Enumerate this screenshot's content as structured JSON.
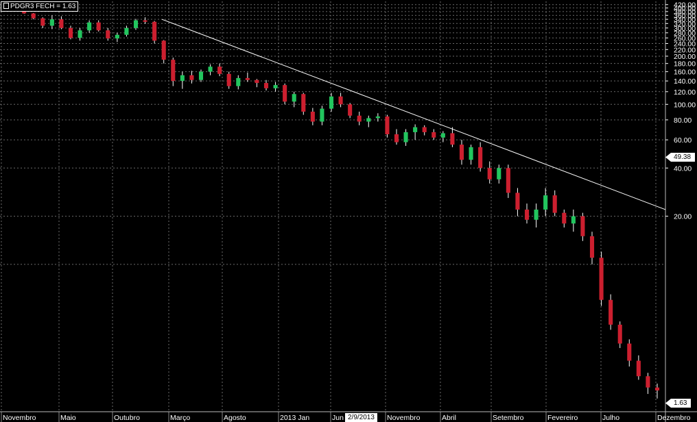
{
  "title": "PDGR3 FECH = 1.63",
  "colors": {
    "up": "#22c55e",
    "down": "#cc1f2f",
    "wick": "#ffffff",
    "grid": "#6b6b6b",
    "trendline": "#ffffff"
  },
  "price_tags": {
    "last": "1.63",
    "marker": "49.38"
  },
  "date_tag": "2/9/2013",
  "chart_data": {
    "type": "candlestick",
    "title": "PDGR3 FECH = 1.63",
    "y_scale": "log",
    "ylim": [
      1.2,
      440
    ],
    "y_ticks": [
      "420.00",
      "400.00",
      "380.00",
      "360.00",
      "340.00",
      "320.00",
      "300.00",
      "280.00",
      "260.00",
      "240.00",
      "220.00",
      "200.00",
      "180.00",
      "160.00",
      "140.00",
      "120.00",
      "100.00",
      "80.00",
      "60.00",
      "40.00",
      "20.00"
    ],
    "x_labels": [
      "Novembro",
      "Maio",
      "Outubro",
      "Março",
      "Agosto",
      "2013 Jan",
      "Jun",
      "Novembro",
      "Abril",
      "Setembro",
      "Fevereiro",
      "Julho",
      "Dezembro"
    ],
    "trendline": {
      "from": {
        "period": "Março",
        "price": 340
      },
      "to": {
        "period": "Dezembro",
        "price": 22
      }
    },
    "series": [
      {
        "values": [
          [
            390,
            400,
            380,
            395
          ],
          [
            395,
            402,
            384,
            386
          ],
          [
            386,
            392,
            368,
            370
          ],
          [
            370,
            372,
            340,
            345
          ],
          [
            345,
            350,
            300,
            310
          ],
          [
            310,
            360,
            295,
            340
          ],
          [
            340,
            355,
            295,
            300
          ],
          [
            300,
            310,
            255,
            260
          ],
          [
            260,
            300,
            250,
            290
          ],
          [
            290,
            335,
            280,
            325
          ],
          [
            325,
            335,
            285,
            290
          ],
          [
            290,
            300,
            250,
            258
          ],
          [
            258,
            280,
            245,
            272
          ],
          [
            272,
            310,
            265,
            300
          ],
          [
            300,
            342,
            292,
            335
          ],
          [
            335,
            350,
            318,
            328
          ],
          [
            328,
            332,
            240,
            250
          ],
          [
            250,
            252,
            180,
            190
          ],
          [
            190,
            196,
            130,
            140
          ],
          [
            140,
            160,
            125,
            152
          ],
          [
            152,
            162,
            135,
            142
          ],
          [
            142,
            165,
            138,
            160
          ],
          [
            160,
            178,
            152,
            172
          ],
          [
            172,
            180,
            150,
            155
          ],
          [
            155,
            160,
            125,
            130
          ],
          [
            130,
            152,
            124,
            146
          ],
          [
            146,
            158,
            138,
            142
          ],
          [
            142,
            144,
            128,
            136
          ],
          [
            136,
            142,
            122,
            126
          ],
          [
            126,
            138,
            120,
            132
          ],
          [
            132,
            135,
            100,
            104
          ],
          [
            104,
            120,
            96,
            116
          ],
          [
            116,
            118,
            86,
            90
          ],
          [
            90,
            95,
            74,
            78
          ],
          [
            78,
            98,
            74,
            94
          ],
          [
            94,
            118,
            90,
            112
          ],
          [
            112,
            118,
            96,
            100
          ],
          [
            100,
            102,
            82,
            85
          ],
          [
            85,
            90,
            74,
            78
          ],
          [
            78,
            85,
            72,
            82
          ],
          [
            82,
            88,
            78,
            84
          ],
          [
            84,
            86,
            62,
            65
          ],
          [
            65,
            70,
            56,
            58
          ],
          [
            58,
            70,
            55,
            67
          ],
          [
            67,
            75,
            60,
            72
          ],
          [
            72,
            74,
            64,
            67
          ],
          [
            67,
            70,
            60,
            62
          ],
          [
            62,
            68,
            58,
            66
          ],
          [
            66,
            72,
            54,
            56
          ],
          [
            56,
            60,
            42,
            45
          ],
          [
            45,
            56,
            42,
            54
          ],
          [
            54,
            58,
            38,
            40
          ],
          [
            40,
            44,
            32,
            34
          ],
          [
            34,
            42,
            32,
            40
          ],
          [
            40,
            42,
            26,
            28
          ],
          [
            28,
            30,
            20,
            22
          ],
          [
            22,
            24,
            18,
            19
          ],
          [
            19,
            24,
            17,
            22
          ],
          [
            22,
            30,
            20,
            27
          ],
          [
            27,
            29,
            20,
            21
          ],
          [
            21,
            22,
            17,
            18
          ],
          [
            18,
            22,
            16,
            20
          ],
          [
            20,
            21,
            14,
            15
          ],
          [
            15,
            16,
            10,
            11
          ],
          [
            11,
            12,
            5.5,
            6
          ],
          [
            6,
            6.5,
            3.9,
            4.2
          ],
          [
            4.2,
            4.4,
            3.0,
            3.2
          ],
          [
            3.2,
            3.4,
            2.3,
            2.5
          ],
          [
            2.5,
            2.7,
            1.9,
            2.0
          ],
          [
            2.0,
            2.1,
            1.55,
            1.7
          ],
          [
            1.7,
            1.8,
            1.45,
            1.63
          ]
        ]
      }
    ]
  }
}
